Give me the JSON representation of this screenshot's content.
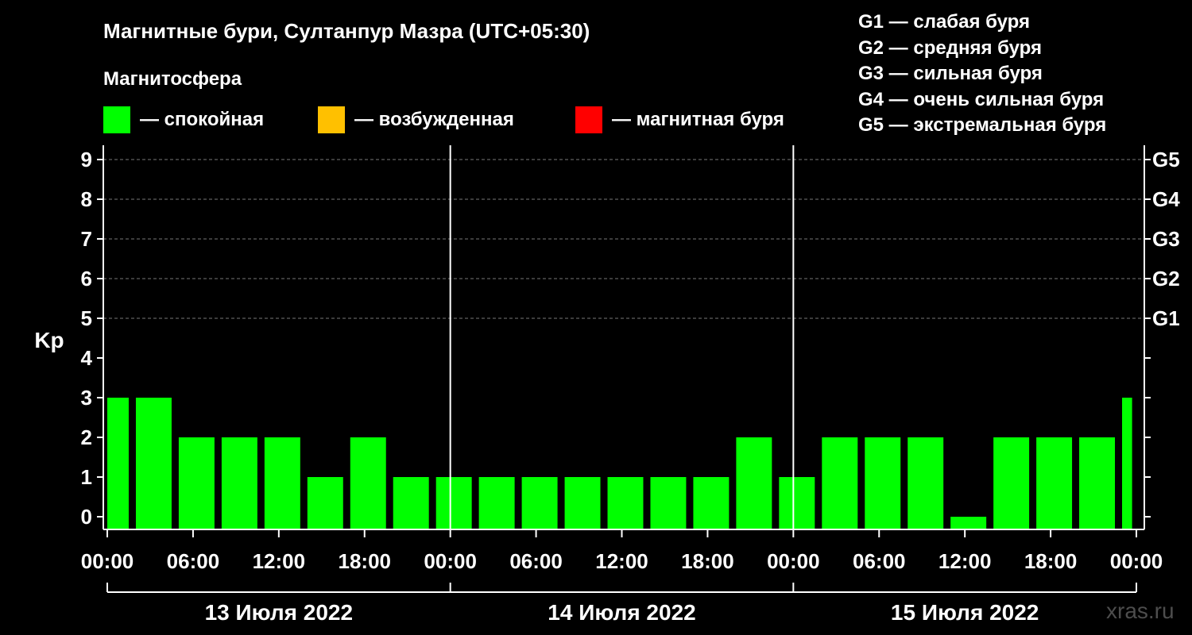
{
  "title": "Магнитные бури, Султанпур Мазра (UTC+05:30)",
  "subtitle": "Магнитосфера",
  "legend": [
    {
      "color": "#00ff00",
      "label": "— спокойная"
    },
    {
      "color": "#ffc000",
      "label": "— возбужденная"
    },
    {
      "color": "#ff0000",
      "label": "— магнитная буря"
    }
  ],
  "g_scale": [
    "G1 — слабая буря",
    "G2 — средняя буря",
    "G3 — сильная буря",
    "G4 — очень сильная буря",
    "G5 — экстремальная буря"
  ],
  "watermark": "xras.ru",
  "chart_data": {
    "type": "bar",
    "ylabel": "Kp",
    "ylim": [
      0,
      9
    ],
    "y_ticks": [
      "0",
      "1",
      "2",
      "3",
      "4",
      "5",
      "6",
      "7",
      "8",
      "9"
    ],
    "right_ticks": [
      {
        "value": 5,
        "label": "G1"
      },
      {
        "value": 6,
        "label": "G2"
      },
      {
        "value": 7,
        "label": "G3"
      },
      {
        "value": 8,
        "label": "G4"
      },
      {
        "value": 9,
        "label": "G5"
      }
    ],
    "grid": "dashed horizontal at Kp 5–9",
    "x_tick_labels": [
      "00:00",
      "06:00",
      "12:00",
      "18:00",
      "00:00",
      "06:00",
      "12:00",
      "18:00",
      "00:00",
      "06:00",
      "12:00",
      "18:00",
      "00:00"
    ],
    "days": [
      "13 Июля 2022",
      "14 Июля 2022",
      "15 Июля 2022"
    ],
    "bar_color": "#00ff00",
    "bars": [
      {
        "start_hour": 0.0,
        "end_hour": 1.5,
        "kp": 3
      },
      {
        "start_hour": 2.0,
        "end_hour": 4.5,
        "kp": 3
      },
      {
        "start_hour": 5.0,
        "end_hour": 7.5,
        "kp": 2
      },
      {
        "start_hour": 8.0,
        "end_hour": 10.5,
        "kp": 2
      },
      {
        "start_hour": 11.0,
        "end_hour": 13.5,
        "kp": 2
      },
      {
        "start_hour": 14.0,
        "end_hour": 16.5,
        "kp": 1
      },
      {
        "start_hour": 17.0,
        "end_hour": 19.5,
        "kp": 2
      },
      {
        "start_hour": 20.0,
        "end_hour": 22.5,
        "kp": 1
      },
      {
        "start_hour": 23.0,
        "end_hour": 25.5,
        "kp": 1
      },
      {
        "start_hour": 26.0,
        "end_hour": 28.5,
        "kp": 1
      },
      {
        "start_hour": 29.0,
        "end_hour": 31.5,
        "kp": 1
      },
      {
        "start_hour": 32.0,
        "end_hour": 34.5,
        "kp": 1
      },
      {
        "start_hour": 35.0,
        "end_hour": 37.5,
        "kp": 1
      },
      {
        "start_hour": 38.0,
        "end_hour": 40.5,
        "kp": 1
      },
      {
        "start_hour": 41.0,
        "end_hour": 43.5,
        "kp": 1
      },
      {
        "start_hour": 44.0,
        "end_hour": 46.5,
        "kp": 2
      },
      {
        "start_hour": 47.0,
        "end_hour": 49.5,
        "kp": 1
      },
      {
        "start_hour": 50.0,
        "end_hour": 52.5,
        "kp": 2
      },
      {
        "start_hour": 53.0,
        "end_hour": 55.5,
        "kp": 2
      },
      {
        "start_hour": 56.0,
        "end_hour": 58.5,
        "kp": 2
      },
      {
        "start_hour": 59.0,
        "end_hour": 61.5,
        "kp": 0
      },
      {
        "start_hour": 62.0,
        "end_hour": 64.5,
        "kp": 2
      },
      {
        "start_hour": 65.0,
        "end_hour": 67.5,
        "kp": 2
      },
      {
        "start_hour": 68.0,
        "end_hour": 70.5,
        "kp": 2
      },
      {
        "start_hour": 71.0,
        "end_hour": 71.7,
        "kp": 3
      }
    ]
  }
}
